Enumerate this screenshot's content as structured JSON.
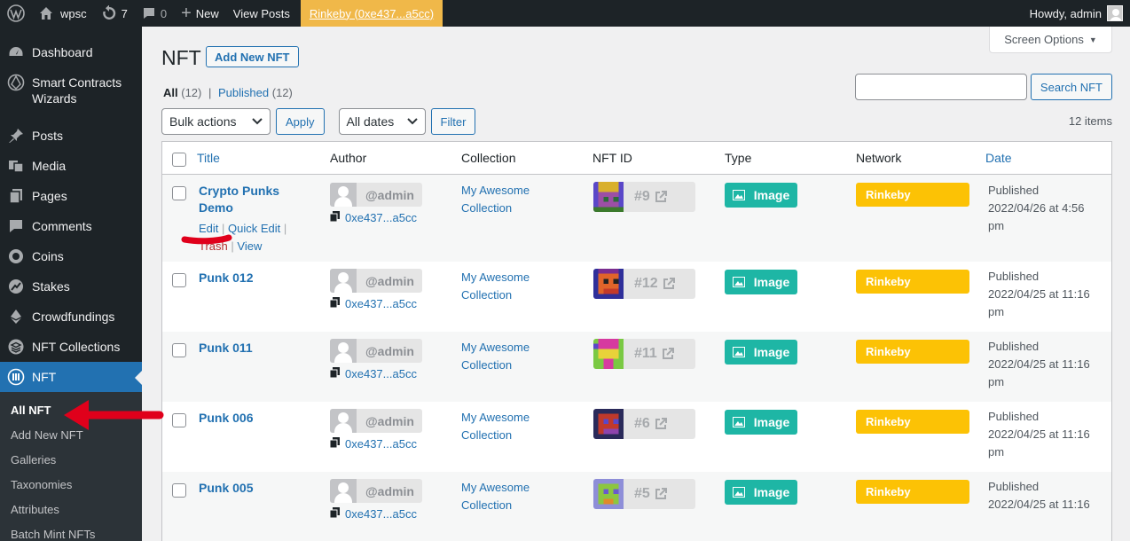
{
  "adminbar": {
    "site_name": "wpsc",
    "updates_count": "7",
    "comments_count": "0",
    "new_label": "New",
    "view_posts_label": "View Posts",
    "network_label": "Rinkeby (0xe437...a5cc)",
    "howdy": "Howdy, admin"
  },
  "sidebar": {
    "items": [
      {
        "label": "Dashboard",
        "icon": "dashboard-icon"
      },
      {
        "label": "Smart Contracts Wizards",
        "icon": "wizard-icon"
      },
      {
        "label": "Posts",
        "icon": "pin-icon"
      },
      {
        "label": "Media",
        "icon": "media-icon"
      },
      {
        "label": "Pages",
        "icon": "pages-icon"
      },
      {
        "label": "Comments",
        "icon": "comments-icon"
      },
      {
        "label": "Coins",
        "icon": "coins-icon"
      },
      {
        "label": "Stakes",
        "icon": "stakes-icon"
      },
      {
        "label": "Crowdfundings",
        "icon": "ethereum-icon"
      },
      {
        "label": "NFT Collections",
        "icon": "stack-icon"
      },
      {
        "label": "NFT",
        "icon": "nft-icon"
      }
    ],
    "submenu": [
      "All NFT",
      "Add New NFT",
      "Galleries",
      "Taxonomies",
      "Attributes",
      "Batch Mint NFTs"
    ]
  },
  "header": {
    "screen_options": "Screen Options",
    "title": "NFT",
    "add_new": "Add New NFT",
    "filters": {
      "all": "All",
      "all_count": "(12)",
      "sep": "|",
      "published": "Published",
      "published_count": "(12)"
    },
    "search_button": "Search NFT",
    "bulk_actions": "Bulk actions",
    "apply": "Apply",
    "all_dates": "All dates",
    "filter": "Filter",
    "items_count": "12 items"
  },
  "table": {
    "columns": {
      "title": "Title",
      "author": "Author",
      "collection": "Collection",
      "nft_id": "NFT ID",
      "type": "Type",
      "network": "Network",
      "date": "Date"
    },
    "row_actions": {
      "edit": "Edit",
      "quick_edit": "Quick Edit",
      "trash": "Trash",
      "view": "View",
      "sep": "|"
    },
    "rows": [
      {
        "title_line1": "Crypto Punks",
        "title_line2": "Demo",
        "author": "@admin",
        "address": "0xe437...a5cc",
        "collection_line1": "My Awesome",
        "collection_line2": "Collection",
        "nft_id": "#9",
        "type": "Image",
        "network": "Rinkeby",
        "date_line1": "Published",
        "date_line2": "2022/04/26 at 4:56",
        "date_line3": "pm"
      },
      {
        "title_line1": "Punk 012",
        "author": "@admin",
        "address": "0xe437...a5cc",
        "collection_line1": "My Awesome",
        "collection_line2": "Collection",
        "nft_id": "#12",
        "type": "Image",
        "network": "Rinkeby",
        "date_line1": "Published",
        "date_line2": "2022/04/25 at 11:16",
        "date_line3": "pm"
      },
      {
        "title_line1": "Punk 011",
        "author": "@admin",
        "address": "0xe437...a5cc",
        "collection_line1": "My Awesome",
        "collection_line2": "Collection",
        "nft_id": "#11",
        "type": "Image",
        "network": "Rinkeby",
        "date_line1": "Published",
        "date_line2": "2022/04/25 at 11:16",
        "date_line3": "pm"
      },
      {
        "title_line1": "Punk 006",
        "author": "@admin",
        "address": "0xe437...a5cc",
        "collection_line1": "My Awesome",
        "collection_line2": "Collection",
        "nft_id": "#6",
        "type": "Image",
        "network": "Rinkeby",
        "date_line1": "Published",
        "date_line2": "2022/04/25 at 11:16",
        "date_line3": "pm"
      },
      {
        "title_line1": "Punk 005",
        "author": "@admin",
        "address": "0xe437...a5cc",
        "collection_line1": "My Awesome",
        "collection_line2": "Collection",
        "nft_id": "#5",
        "type": "Image",
        "network": "Rinkeby",
        "date_line1": "Published",
        "date_line2": "2022/04/25 at 11:16",
        "date_line3": ""
      }
    ]
  },
  "colors": {
    "accent": "#2271b1",
    "type_badge": "#1eb6a5",
    "network_badge": "#fcc205",
    "annotation": "#e0001b",
    "network_bar": "#f0b849"
  }
}
